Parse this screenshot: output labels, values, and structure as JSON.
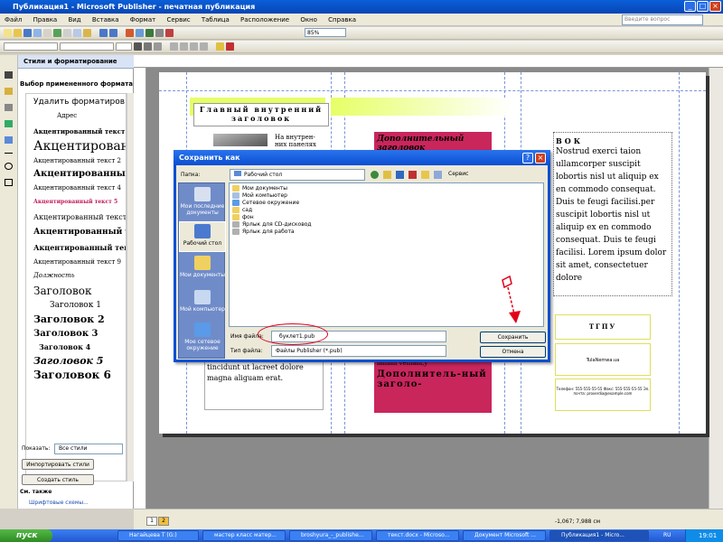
{
  "window": {
    "title": "Публикация1 - Microsoft Publisher - печатная публикация",
    "help_placeholder": "Введите вопрос",
    "controls": [
      "_",
      "□",
      "×"
    ]
  },
  "menu": [
    "Файл",
    "Правка",
    "Вид",
    "Вставка",
    "Формат",
    "Сервис",
    "Таблица",
    "Расположение",
    "Окно",
    "Справка"
  ],
  "toolbar": {
    "zoom": "85%"
  },
  "taskpane": {
    "title": "Стили и форматирование",
    "section_label": "Выбор примененного формата",
    "styles": [
      {
        "name": "Удалить форматиров"
      },
      {
        "name": "Адрес"
      },
      {
        "name": "Акцентированный текст"
      },
      {
        "name": "Акцентирован"
      },
      {
        "name": "Акцентированный текст 2"
      },
      {
        "name": "Акцентированный"
      },
      {
        "name": "Акцентированный текст 4"
      },
      {
        "name": "Акцентированный текст 5"
      },
      {
        "name": "Акцентированный текст"
      },
      {
        "name": "Акцентированный т"
      },
      {
        "name": "Акцентированный тек"
      },
      {
        "name": "Акцентированный текст 9"
      },
      {
        "name": "Должность"
      },
      {
        "name": "Заголовок"
      },
      {
        "name": "Заголовок 1"
      },
      {
        "name": "Заголовок 2"
      },
      {
        "name": "Заголовок 3"
      },
      {
        "name": "Заголовок 4"
      },
      {
        "name": "Заголовок 5"
      },
      {
        "name": "Заголовок 6"
      }
    ],
    "show_label": "Показать:",
    "show_value": "Все стили",
    "import_button": "Импортировать стили",
    "create_button": "Создать стиль",
    "see_also": "См. также",
    "font_schemes_link": "Шрифтовые схемы..."
  },
  "publication": {
    "heading_box": "Главный внутренний заголовок",
    "inner_text": "На внутрен-них панелях",
    "secondary_heading": "Дополнительный заголовок",
    "column_heading": "ВОК",
    "column_text": "Nostrud exerci taion ullamcorper suscipit lobortis nisl ut aliquip ex en commodo consequat. Duis te feugi facilisi.per suscipit lobortis nisl ut aliquip ex en commodo consequat. Duis te feugi facilisi. Lorem ipsum dolor sit amet, consectetuer dolore",
    "lower_left_text": "tincidunt ut lacreet dolore magna aliguam erat.",
    "lower_mid_text": "minim veniam,y",
    "lower_mid_heading": "Дополнитель-ный заголо-",
    "org_name": "ТГПУ",
    "org_url": "TulaNemwa.ua",
    "contacts": "Телефон: 555-555-55-55 Факс: 555-555-55-55 Эл. почта: proverdia@example.com"
  },
  "dialog": {
    "title": "Сохранить как",
    "folder_label": "Папка:",
    "folder_value": "Рабочий стол",
    "tools_label": "Сервис",
    "places": [
      {
        "label": "Мои последние документы",
        "icon": "recent-docs-icon"
      },
      {
        "label": "Рабочий стол",
        "icon": "desktop-icon"
      },
      {
        "label": "Мои документы",
        "icon": "my-documents-icon"
      },
      {
        "label": "Мой компьютер",
        "icon": "my-computer-icon"
      },
      {
        "label": "Мое сетевое окружение",
        "icon": "network-icon"
      }
    ],
    "files": [
      {
        "name": "Мои документы",
        "icon": "folder-icon"
      },
      {
        "name": "Мой компьютер",
        "icon": "computer-icon"
      },
      {
        "name": "Сетевое окружение",
        "icon": "network-icon"
      },
      {
        "name": "сад",
        "icon": "folder-icon"
      },
      {
        "name": "фон",
        "icon": "folder-icon"
      },
      {
        "name": "Ярлык для CD-дисковод",
        "icon": "shortcut-icon"
      },
      {
        "name": "Ярлык для работа",
        "icon": "shortcut-icon"
      }
    ],
    "filename_label": "Имя файла:",
    "filename_value": "буклет1.pub",
    "filetype_label": "Тип файла:",
    "filetype_value": "Файлы Publisher (*.pub)",
    "save_button": "Сохранить",
    "cancel_button": "Отмена"
  },
  "statusbar": {
    "pages": [
      "1",
      "2"
    ],
    "coords": "-1,067; 7,988 см"
  },
  "taskbar": {
    "start": "пуск",
    "items": [
      "Нагайцева Т (G:)",
      "мастер класс матер...",
      "broshyura_-_publishe...",
      "текст.docx - Microso...",
      "Документ Microsoft ...",
      "Публикация1 - Micro..."
    ],
    "lang": "RU",
    "clock": "19:01"
  },
  "colors": {
    "accent": "#0a4fd0",
    "pink_box": "#c9265c",
    "lime_band": "#e6ff66",
    "annotation": "#e0001a"
  }
}
